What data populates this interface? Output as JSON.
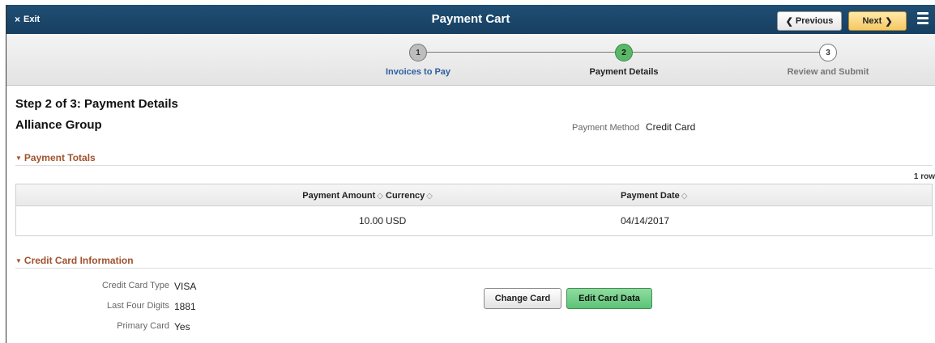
{
  "header": {
    "exit_label": "Exit",
    "title": "Payment Cart",
    "previous_label": "Previous",
    "next_label": "Next"
  },
  "train": {
    "stops": [
      {
        "number": "1",
        "label": "Invoices to Pay"
      },
      {
        "number": "2",
        "label": "Payment Details"
      },
      {
        "number": "3",
        "label": "Review and Submit"
      }
    ]
  },
  "content": {
    "step_title": "Step 2 of 3: Payment Details",
    "org_name": "Alliance Group",
    "payment_method_label": "Payment Method",
    "payment_method_value": "Credit Card"
  },
  "payment_totals": {
    "section_title": "Payment Totals",
    "row_count": "1 row",
    "columns": [
      "Payment Amount",
      "Currency",
      "Payment Date"
    ],
    "rows": [
      {
        "amount": "10.00",
        "currency": "USD",
        "date": "04/14/2017"
      }
    ]
  },
  "credit_card": {
    "section_title": "Credit Card Information",
    "fields": [
      {
        "label": "Credit Card Type",
        "value": "VISA"
      },
      {
        "label": "Last Four Digits",
        "value": "1881"
      },
      {
        "label": "Primary Card",
        "value": "Yes"
      }
    ],
    "change_card_label": "Change Card",
    "edit_card_label": "Edit Card Data"
  },
  "colors": {
    "header_bg": "#1f4e74",
    "section_title": "#a0522d",
    "active_step": "#5bb768",
    "next_button": "#f5c864",
    "edit_button": "#5cc377"
  }
}
